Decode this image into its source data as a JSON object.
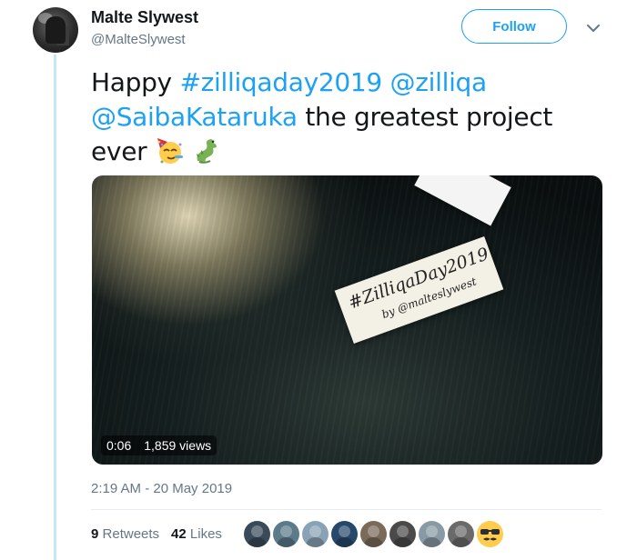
{
  "author": {
    "name": "Malte Slywest",
    "handle": "@MalteSlywest"
  },
  "header": {
    "follow_label": "Follow",
    "menu_icon": "chevron-down-icon"
  },
  "tweet": {
    "word_happy": "Happy",
    "hashtag": "#zilliqaday2019",
    "mention_1": "@zilliqa",
    "mention_2": "@SaibaKataruka",
    "text_rest": " the greatest project ever ",
    "emojis": [
      "partying-face-icon",
      "dragon-icon"
    ]
  },
  "video": {
    "duration": "0:06",
    "views": "1,859 views",
    "card_line1": "#ZilliqaDay2019",
    "card_line2": "by @malteslywest"
  },
  "timestamp": "2:19 AM - 20 May 2019",
  "stats": {
    "retweets_count": "9",
    "retweets_label": "Retweets",
    "likes_count": "42",
    "likes_label": "Likes"
  },
  "likers": {
    "colors": [
      "#3a4a5a",
      "#5b7a8a",
      "#8aa2b5",
      "#27486a",
      "#7a6a5a",
      "#4a4a4a",
      "#8a9aa5",
      "#6a6a6a",
      "#ffcc4d"
    ]
  }
}
